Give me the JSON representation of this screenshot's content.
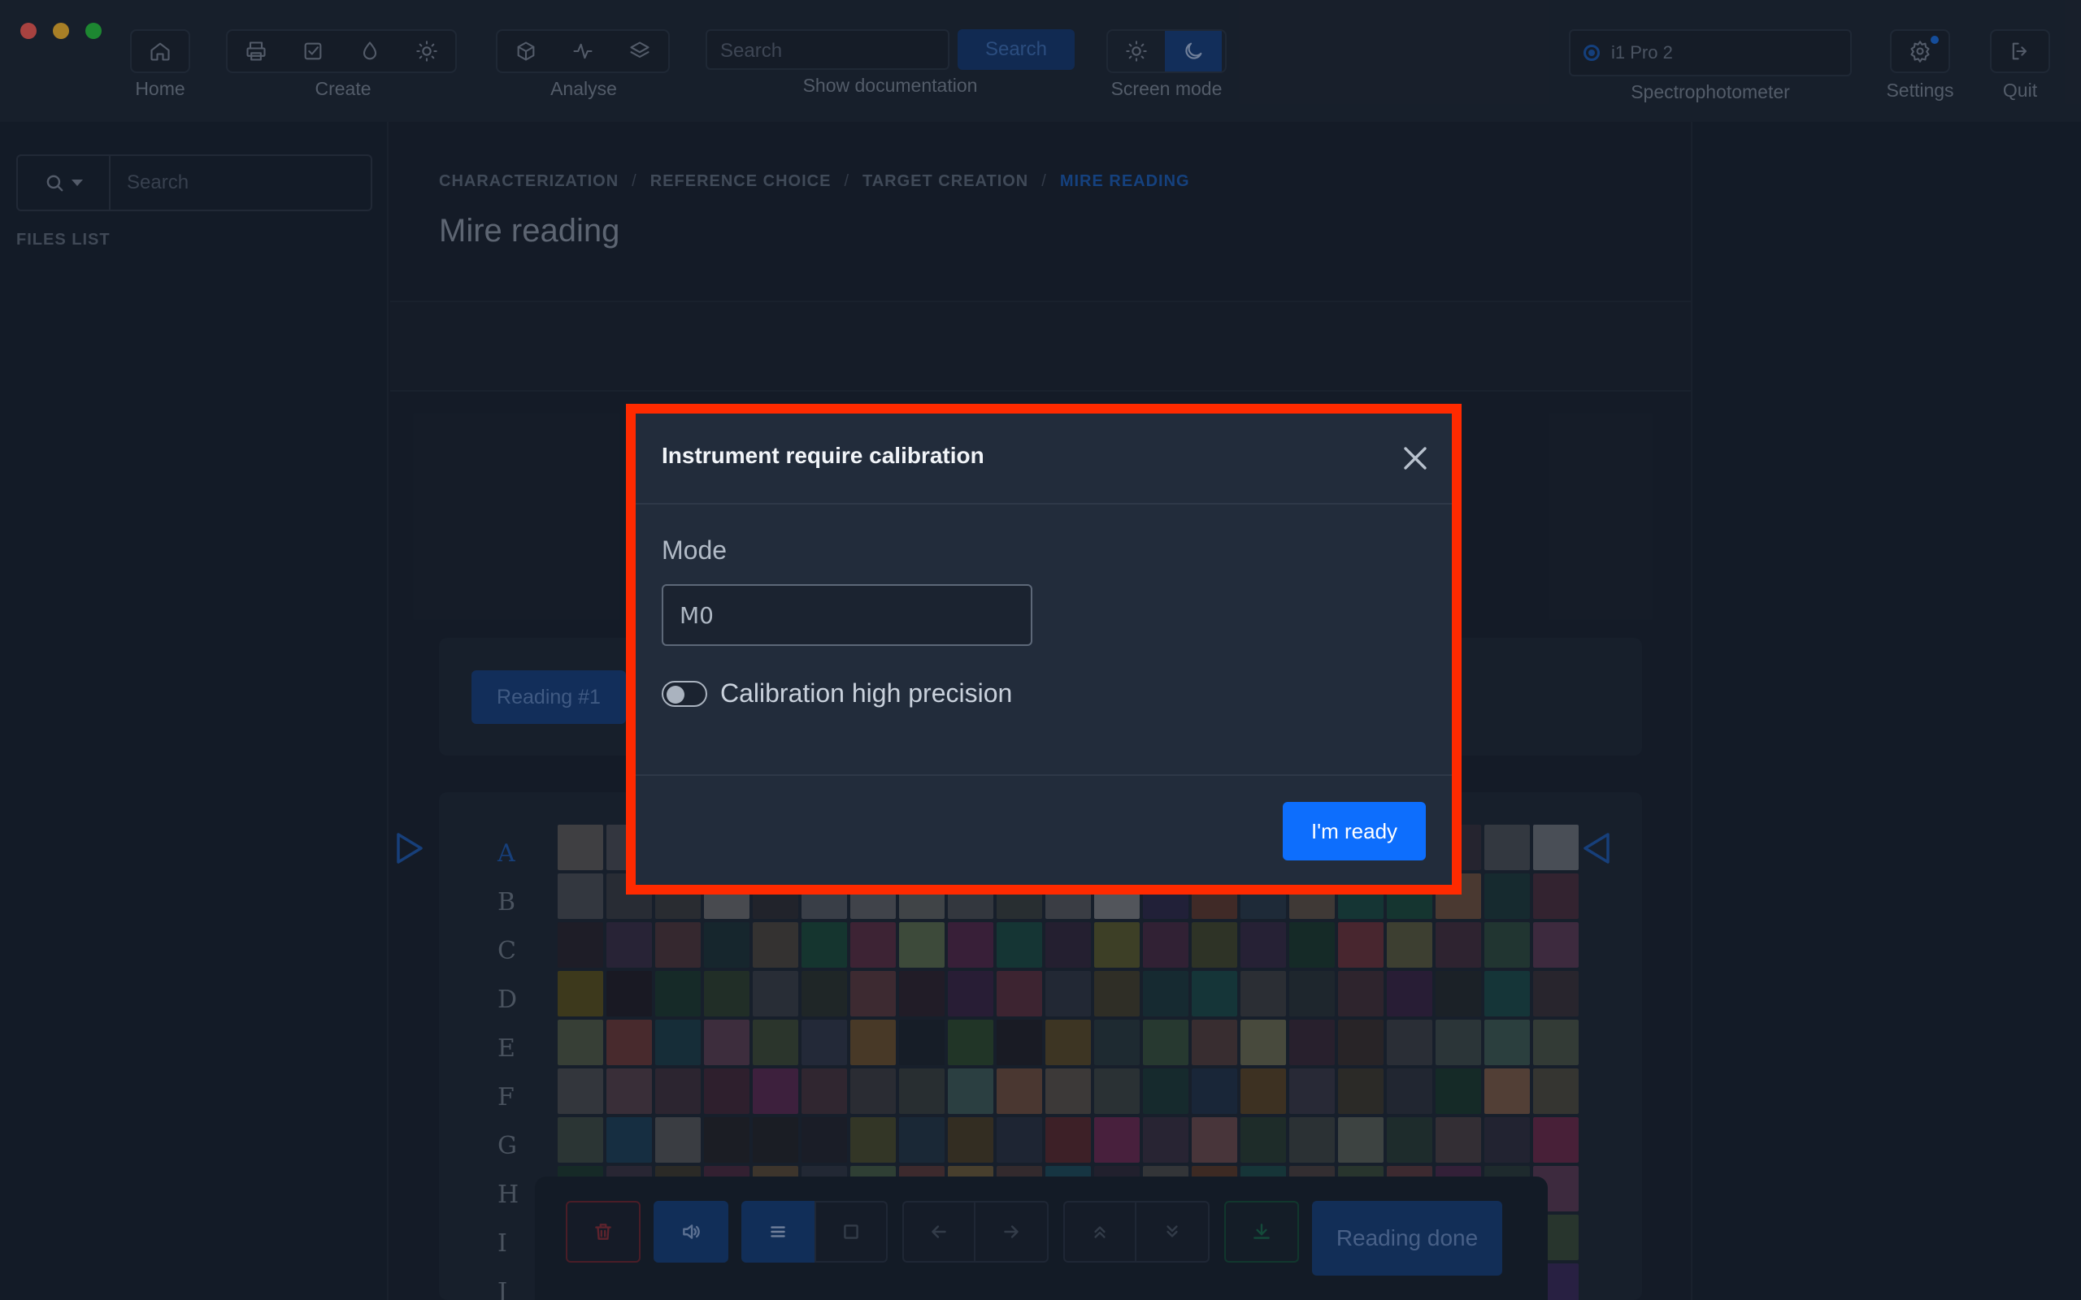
{
  "toolbar": {
    "home_label": "Home",
    "create_label": "Create",
    "analyse_label": "Analyse",
    "search_placeholder": "Search",
    "search_button": "Search",
    "docs_label": "Show documentation",
    "screen_mode_label": "Screen mode",
    "spectro_device": "i1 Pro 2",
    "spectro_label": "Spectrophotometer",
    "settings_label": "Settings",
    "quit_label": "Quit"
  },
  "sidebar": {
    "search_placeholder": "Search",
    "files_title": "FILES LIST"
  },
  "breadcrumb": {
    "items": [
      "CHARACTERIZATION",
      "REFERENCE CHOICE",
      "TARGET CREATION"
    ],
    "current": "MIRE READING",
    "separator": "/"
  },
  "page": {
    "title": "Mire reading",
    "reading_tab": "Reading #1",
    "rows": [
      "A",
      "B",
      "C",
      "D",
      "E",
      "F",
      "G",
      "H",
      "I",
      "J"
    ],
    "reading_done": "Reading done"
  },
  "modal": {
    "title": "Instrument require calibration",
    "mode_label": "Mode",
    "mode_value": "M0",
    "toggle_label": "Calibration high precision",
    "toggle_on": false,
    "ready_button": "I'm ready"
  },
  "colors": {
    "accent": "#0d6efd",
    "highlight": "#ff2a00"
  },
  "swatch_colors": [
    [
      "#5c5959",
      "#4a4c55",
      "#3e4147",
      "#45434c",
      "#2b2f3c",
      "#3a3a48",
      "#4a4040",
      "#3f3a3c",
      "#33313b",
      "#4a3a3a",
      "#2c3341",
      "#3c3c45",
      "#414a3a",
      "#2d2a36",
      "#3d4a4a",
      "#41414a",
      "#2e3a3a",
      "#3b3a4a",
      "#35303d",
      "#4b4f56",
      "#6c7079"
    ],
    [
      "#4a4d55",
      "#3a3c44",
      "#3b3d40",
      "#6a6b6d",
      "#2f2f37",
      "#545862",
      "#5e6066",
      "#5f6261",
      "#4a4e54",
      "#3a4040",
      "#55575c",
      "#7a7c80",
      "#2e2a4a",
      "#5e3a30",
      "#2a3a4a",
      "#5c5048",
      "#1d4a44",
      "#1d4a3e",
      "#6e5040",
      "#1e3a3c",
      "#4a2e3e"
    ],
    [
      "#2a2630",
      "#3a2e48",
      "#4d363c",
      "#1e343a",
      "#4c4640",
      "#1c4a3c",
      "#5a2e44",
      "#5a6a4e",
      "#52284a",
      "#1c4a44",
      "#34283e",
      "#5a5a2e",
      "#482c44",
      "#42482e",
      "#362c46",
      "#1c3a30",
      "#6a343c",
      "#5a5a40",
      "#422e3e",
      "#2e4a40",
      "#5a3a54"
    ],
    [
      "#5a5020",
      "#22202a",
      "#1e3a32",
      "#2e4030",
      "#3a3e48",
      "#2c3430",
      "#5a3a40",
      "#2e2430",
      "#3a2646",
      "#5a3040",
      "#303644",
      "#44402e",
      "#1e3a40",
      "#1c4a4a",
      "#3e4044",
      "#2a343a",
      "#42303a",
      "#3a2646",
      "#262c30",
      "#1c4a4a",
      "#3a323a"
    ],
    [
      "#505a48",
      "#6a3a3a",
      "#1e3e4a",
      "#5a3e52",
      "#3e4a38",
      "#32384a",
      "#6a5030",
      "#1e2630",
      "#2e4a30",
      "#22222c",
      "#5a4a2a",
      "#2a3a40",
      "#38503e",
      "#523e3e",
      "#6a6a52",
      "#3a2a3a",
      "#3a3030",
      "#3c4048",
      "#3e4a4a",
      "#3e5a54",
      "#4a5448"
    ],
    [
      "#4a4c50",
      "#54404a",
      "#40323e",
      "#42283a",
      "#5a2a52",
      "#46343e",
      "#3c3c42",
      "#3a4040",
      "#3e5a58",
      "#6e4e40",
      "#58504a",
      "#3c4444",
      "#1e3a3a",
      "#22344a",
      "#5a4428",
      "#3a3848",
      "#3e3a30",
      "#2e3440",
      "#1c3a30",
      "#7a5a48",
      "#4e4a40"
    ],
    [
      "#3e4a44",
      "#1e4058",
      "#55565a",
      "#26262c",
      "#24262c",
      "#242630",
      "#4a4c2e",
      "#243648",
      "#4a3e28",
      "#2a3242",
      "#5a2a30",
      "#6a2a52",
      "#3a3042",
      "#6a4a4e",
      "#2a3c34",
      "#3e4444",
      "#5a6058",
      "#2a3c38",
      "#4a4044",
      "#302e40",
      "#6a2a4a"
    ],
    [
      "#1e3a30",
      "#3a3442",
      "#3e3a2e",
      "#4a2a40",
      "#5a4a38",
      "#303644",
      "#445a44",
      "#5a3a3a",
      "#6a5a3a",
      "#4a3a3a",
      "#1e4a5a",
      "#2e2a3a",
      "#4a4a4a",
      "#5a3a2a",
      "#1e4a4a",
      "#4a4040",
      "#3a4a3a",
      "#5a3a3e",
      "#4a2a4a",
      "#2a3a3a",
      "#5a3a54"
    ],
    [
      "#2a3a3a",
      "#4a3a4a",
      "#3a3a2e",
      "#4a4a3a",
      "#2a2e3a",
      "#3a4a4a",
      "#4a3a2e",
      "#3a2e4a",
      "#2e4a3a",
      "#4a2e3a",
      "#3a3a4a",
      "#2e3a2e",
      "#4a4a2e",
      "#3a2e2e",
      "#2e2e4a",
      "#4a3a3a",
      "#3a4a2e",
      "#2e3a4a",
      "#4a2e4a",
      "#1e4a4a",
      "#3a4a3a"
    ],
    [
      "#2a2e3a",
      "#3a2e3a",
      "#2e3a3a",
      "#3a3a2e",
      "#2e2e3a",
      "#3a2e2e",
      "#2e3a2e",
      "#3a3a3a",
      "#2e2e2e",
      "#3a2e3a",
      "#2e3a3a",
      "#3a3a2e",
      "#2e2e3a",
      "#3a2e2e",
      "#2e3a2e",
      "#3a3a3a",
      "#2e2e2e",
      "#3a2e3a",
      "#2e3a3a",
      "#3a3a2e",
      "#3a2a5a"
    ]
  ]
}
